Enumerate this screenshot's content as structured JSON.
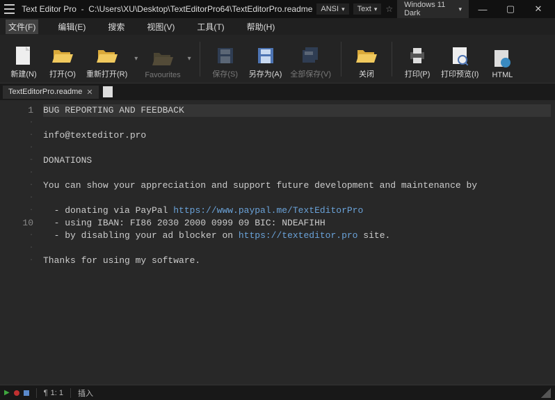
{
  "titlebar": {
    "app_name": "Text Editor Pro",
    "path": "C:\\Users\\XU\\Desktop\\TextEditorPro64\\TextEditorPro.readme",
    "combo_encoding": "ANSI",
    "combo_format": "Text",
    "combo_theme": "Windows 11 Dark"
  },
  "menu": {
    "file": "文件(F)",
    "edit": "编辑(E)",
    "search": "搜索",
    "view": "视图(V)",
    "tools": "工具(T)",
    "help": "帮助(H)"
  },
  "ribbon": {
    "new": "新建(N)",
    "open": "打开(O)",
    "reopen": "重新打开(R)",
    "favourites": "Favourites",
    "save": "保存(S)",
    "saveas": "另存为(A)",
    "saveall": "全部保存(V)",
    "close": "关闭",
    "print": "打印(P)",
    "printpreview": "打印预览(I)",
    "html": "HTML"
  },
  "tab": {
    "name": "TextEditorPro.readme"
  },
  "editor": {
    "lines": [
      {
        "n": "1",
        "text": "BUG REPORTING AND FEEDBACK",
        "hl": true
      },
      {
        "n": "·",
        "text": ""
      },
      {
        "n": "·",
        "text": "info@texteditor.pro"
      },
      {
        "n": "·",
        "text": ""
      },
      {
        "n": "-",
        "text": "DONATIONS"
      },
      {
        "n": "·",
        "text": ""
      },
      {
        "n": "·",
        "text": "You can show your appreciation and support future development and maintenance by"
      },
      {
        "n": "·",
        "text": ""
      },
      {
        "n": "·",
        "text": "  - donating via PayPal ",
        "link": "https://www.paypal.me/TextEditorPro"
      },
      {
        "n": "10",
        "text": "  - using IBAN: FI86 2030 2000 0999 09 BIC: NDEAFIHH"
      },
      {
        "n": "·",
        "text": "  - by disabling your ad blocker on ",
        "link": "https://texteditor.pro",
        "after": " site."
      },
      {
        "n": "·",
        "text": ""
      },
      {
        "n": "·",
        "text": "Thanks for using my software."
      }
    ]
  },
  "status": {
    "pos": "1: 1",
    "mode": "插入"
  }
}
